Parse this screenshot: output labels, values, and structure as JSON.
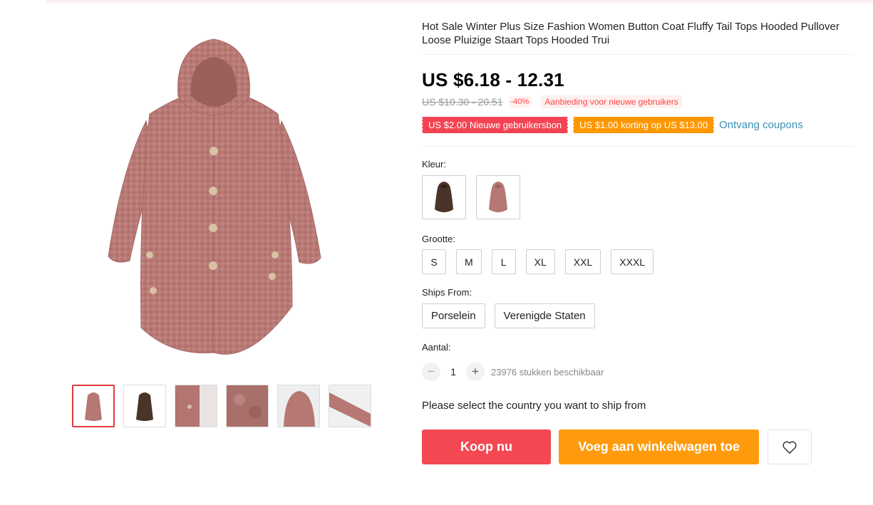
{
  "product": {
    "title": "Hot Sale Winter Plus Size Fashion Women Button Coat Fluffy Tail Tops Hooded Pullover Loose Pluizige Staart Tops Hooded Trui",
    "price": "US $6.18 - 12.31",
    "original_price": "US $10.30 - 20.51",
    "discount": "-40%",
    "new_user_deal": "Aanbieding voor nieuwe gebruikers"
  },
  "coupons": {
    "new_user_coupon": "US $2.00 Nieuwe gebruikersbon",
    "store_coupon": "US $1.00 korting op US $13.00",
    "get_coupons": "Ontvang coupons"
  },
  "color": {
    "label": "Kleur:",
    "options": [
      {
        "name": "brown",
        "fill": "#4a3328"
      },
      {
        "name": "pink",
        "fill": "#b57873"
      }
    ]
  },
  "size": {
    "label": "Grootte:",
    "options": [
      "S",
      "M",
      "L",
      "XL",
      "XXL",
      "XXXL"
    ]
  },
  "ships_from": {
    "label": "Ships From:",
    "options": [
      "Porselein",
      "Verenigde Staten"
    ]
  },
  "quantity": {
    "label": "Aantal:",
    "minus": "−",
    "value": "1",
    "plus": "+",
    "stock": "23976 stukken beschikbaar"
  },
  "ship_note": "Please select the country you want to ship from",
  "actions": {
    "buy_now": "Koop nu",
    "add_to_cart": "Voeg aan winkelwagen toe"
  },
  "gallery": {
    "selected_index": 0,
    "thumbnails": [
      "pink-coat",
      "brown-coat",
      "fabric-detail-1",
      "fabric-detail-2",
      "hood-detail",
      "sleeve-detail"
    ]
  },
  "colors": {
    "accent_red": "#f44852",
    "accent_orange": "#ff9a0c",
    "link_blue": "#3d8fb5",
    "coat_pink": "#b57873",
    "coat_brown": "#4a3328"
  }
}
